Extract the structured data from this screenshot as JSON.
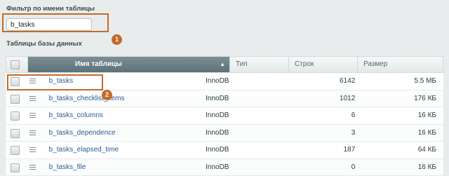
{
  "filter": {
    "title": "Фильтр по имени таблицы",
    "value": "b_tasks"
  },
  "markers": {
    "one": "1",
    "two": "2"
  },
  "section_title": "Таблицы базы данных",
  "table": {
    "columns": {
      "name": "Имя таблицы",
      "type": "Тип",
      "rows": "Строк",
      "size": "Размер"
    },
    "sort_indicator": "▲",
    "rows": [
      {
        "name": "b_tasks",
        "type": "InnoDB",
        "rows": "6142",
        "size": "5.5 МБ"
      },
      {
        "name": "b_tasks_checklist_items",
        "type": "InnoDB",
        "rows": "1012",
        "size": "176 КБ"
      },
      {
        "name": "b_tasks_columns",
        "type": "InnoDB",
        "rows": "6",
        "size": "16 КБ"
      },
      {
        "name": "b_tasks_dependence",
        "type": "InnoDB",
        "rows": "3",
        "size": "16 КБ"
      },
      {
        "name": "b_tasks_elapsed_time",
        "type": "InnoDB",
        "rows": "187",
        "size": "64 КБ"
      },
      {
        "name": "b_tasks_file",
        "type": "InnoDB",
        "rows": "0",
        "size": "16 КБ"
      }
    ]
  },
  "colors": {
    "highlight": "#c36a2b",
    "header_active": "#6a7f86",
    "link": "#2e5b8f"
  }
}
